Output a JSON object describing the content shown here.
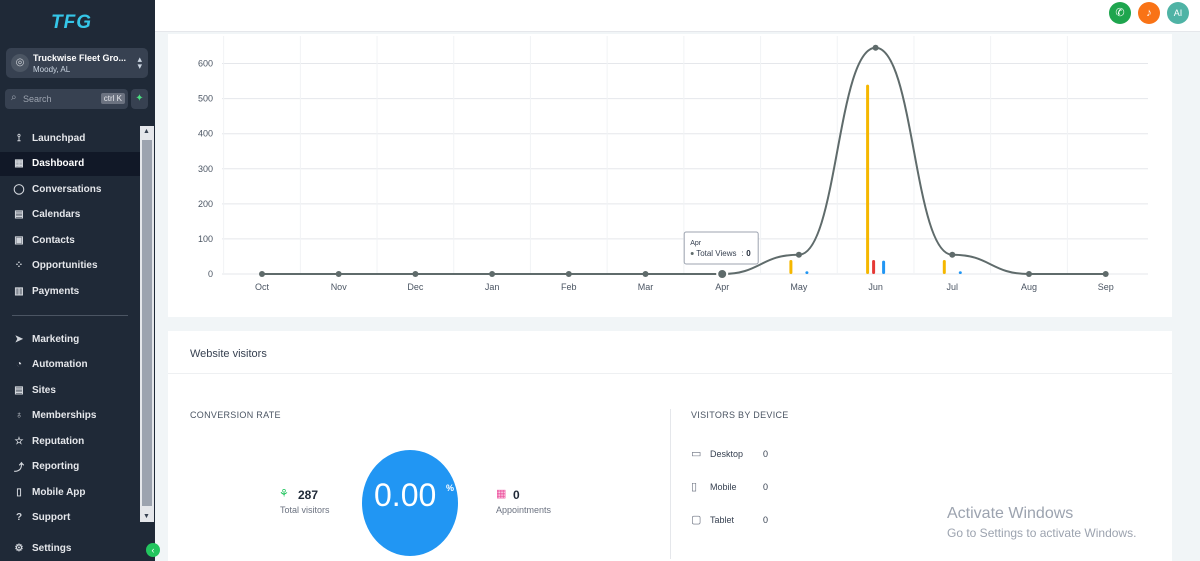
{
  "sidebar": {
    "logo": "TFG",
    "account": {
      "avatar_icon": "location-icon",
      "name": "Truckwise Fleet Gro...",
      "location": "Moody, AL"
    },
    "search": {
      "placeholder": "Search",
      "shortcut": "ctrl K"
    },
    "nav_top": [
      {
        "label": "Launchpad",
        "icon": "rocket-icon"
      },
      {
        "label": "Dashboard",
        "icon": "grid-icon",
        "active": true
      },
      {
        "label": "Conversations",
        "icon": "chat-icon"
      },
      {
        "label": "Calendars",
        "icon": "calendar-icon"
      },
      {
        "label": "Contacts",
        "icon": "contact-icon"
      },
      {
        "label": "Opportunities",
        "icon": "opportunity-icon"
      },
      {
        "label": "Payments",
        "icon": "payment-icon"
      }
    ],
    "nav_bottom": [
      {
        "label": "Marketing",
        "icon": "send-icon"
      },
      {
        "label": "Automation",
        "icon": "automation-icon"
      },
      {
        "label": "Sites",
        "icon": "sites-icon"
      },
      {
        "label": "Memberships",
        "icon": "membership-icon"
      },
      {
        "label": "Reputation",
        "icon": "star-icon"
      },
      {
        "label": "Reporting",
        "icon": "trend-icon"
      },
      {
        "label": "Mobile App",
        "icon": "phone-icon"
      },
      {
        "label": "Support",
        "icon": "help-icon"
      }
    ],
    "settings_label": "Settings"
  },
  "topbar": {
    "avatar_initials": "AI",
    "colors": {
      "phone": "#1ea54e",
      "bell": "#f97316",
      "avatar": "#4fb3a5"
    }
  },
  "chart_data": {
    "type": "line",
    "categories": [
      "Oct",
      "Nov",
      "Dec",
      "Jan",
      "Feb",
      "Mar",
      "Apr",
      "May",
      "Jun",
      "Jul",
      "Aug",
      "Sep"
    ],
    "series": [
      {
        "values": [
          0,
          0,
          0,
          0,
          0,
          0,
          0,
          55,
          645,
          55,
          0,
          0
        ]
      }
    ],
    "bars": [
      {
        "color": "#f5b700",
        "values": [
          0,
          0,
          0,
          0,
          0,
          0,
          0,
          40,
          540,
          40,
          0,
          0
        ]
      },
      {
        "color": "#e53935",
        "values": [
          0,
          0,
          0,
          0,
          0,
          0,
          0,
          0,
          40,
          0,
          0,
          0
        ]
      },
      {
        "color": "#2196f3",
        "values": [
          0,
          0,
          0,
          0,
          0,
          0,
          0,
          8,
          38,
          8,
          0,
          0
        ]
      }
    ],
    "yticks": [
      0,
      100,
      200,
      300,
      400,
      500,
      600
    ],
    "ylim": [
      0,
      650
    ],
    "grid": true,
    "tooltip": {
      "title": "Apr",
      "label": "Total Views",
      "value": "0"
    }
  },
  "visitors": {
    "title": "Website visitors",
    "conversion_label": "CONVERSION RATE",
    "total_visitors": {
      "value": "287",
      "label": "Total visitors"
    },
    "rate": {
      "value": "0.00",
      "unit": "%"
    },
    "appointments": {
      "value": "0",
      "label": "Appointments"
    },
    "device_label": "VISITORS BY DEVICE",
    "devices": [
      {
        "name": "Desktop",
        "count": "0",
        "icon": "desktop-icon"
      },
      {
        "name": "Mobile",
        "count": "0",
        "icon": "mobile-icon"
      },
      {
        "name": "Tablet",
        "count": "0",
        "icon": "tablet-icon"
      }
    ]
  },
  "watermark": {
    "title": "Activate Windows",
    "subtitle": "Go to Settings to activate Windows."
  }
}
